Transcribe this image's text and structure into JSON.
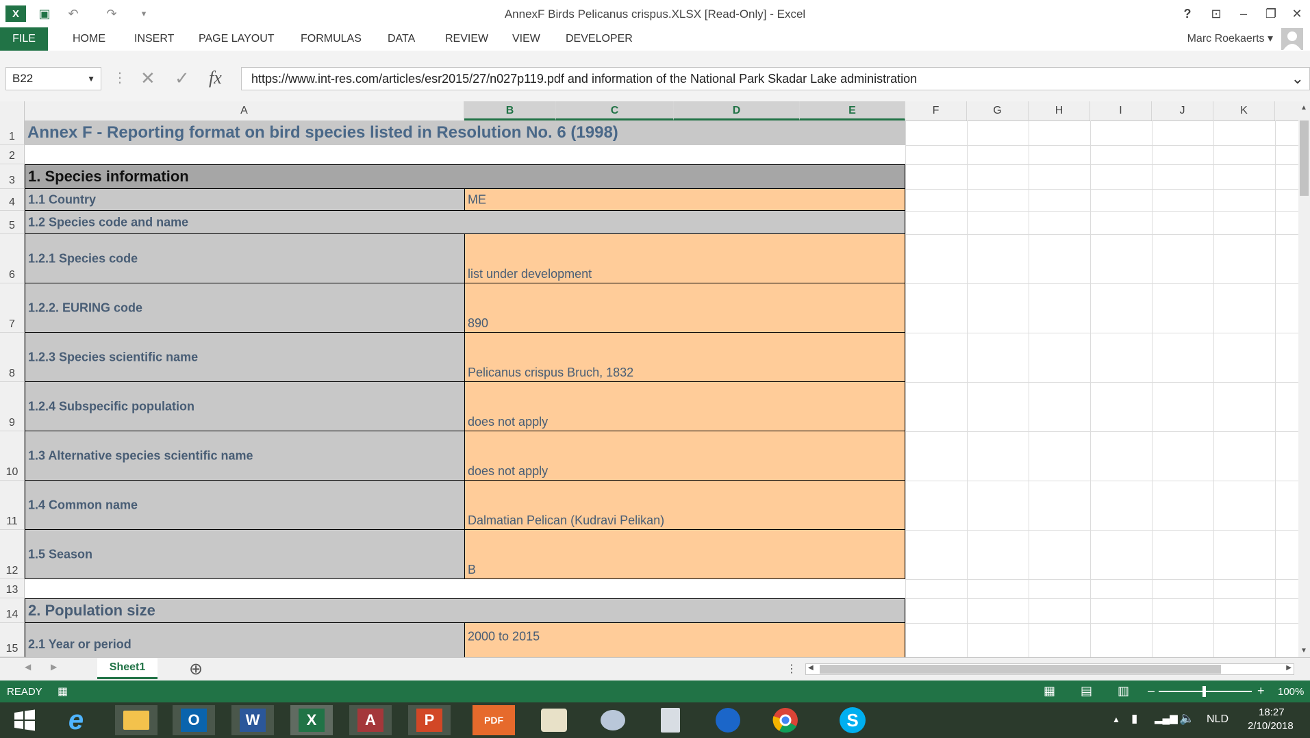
{
  "window": {
    "title": "AnnexF Birds Pelicanus crispus.XLSX  [Read-Only] - Excel",
    "help": "?",
    "ribbon_display": "⊡",
    "minimize": "–",
    "restore": "❐",
    "close": "✕"
  },
  "quick_access": {
    "app_icon": "X",
    "save_icon": "▣",
    "undo_icon": "↶",
    "redo_icon": "↷",
    "customize_icon": "▾"
  },
  "ribbon": {
    "tabs": [
      "FILE",
      "HOME",
      "INSERT",
      "PAGE LAYOUT",
      "FORMULAS",
      "DATA",
      "REVIEW",
      "VIEW",
      "DEVELOPER"
    ],
    "user": "Marc Roekaerts ▾"
  },
  "formula_bar": {
    "name_box": "B22",
    "formula": "https://www.int-res.com/articles/esr2015/27/n027p119.pdf and information of the National Park Skadar Lake administration",
    "fx": "fx",
    "cancel": "✕",
    "enter": "✓",
    "dots": "⋮",
    "expand": "⌄"
  },
  "columns": [
    "A",
    "B",
    "C",
    "D",
    "E",
    "F",
    "G",
    "H",
    "I",
    "J",
    "K"
  ],
  "rows": [
    "1",
    "2",
    "3",
    "4",
    "5",
    "6",
    "7",
    "8",
    "9",
    "10",
    "11",
    "12",
    "13",
    "14",
    "15"
  ],
  "cells": {
    "title": "Annex F - Reporting format on bird species listed in Resolution No. 6 (1998)",
    "s1": "1.   Species information",
    "r4_label": "1.1    Country",
    "r4_value": "ME",
    "r5_label": "1.2    Species code and name",
    "r6_label": "1.2.1 Species code",
    "r6_value": "list under development",
    "r7_label": "1.2.2. EURING code",
    "r7_value": "890",
    "r8_label": "1.2.3 Species scientific name",
    "r8_value": "Pelicanus crispus Bruch, 1832",
    "r9_label": "1.2.4 Subspecific population",
    "r9_value": "does not apply",
    "r10_label": "1.3 Alternative species scientific name",
    "r10_value": "does not apply",
    "r11_label": "1.4 Common name",
    "r11_value": "Dalmatian Pelican (Kudravi Pelikan)",
    "r12_label": "1.5 Season",
    "r12_value": "B",
    "s2": "2.   Population size",
    "r15_label": "2.1 Year or period",
    "r15_value": "2000 to 2015"
  },
  "sheets": {
    "active": "Sheet1",
    "add": "⊕",
    "prev": "◀",
    "next": "▶"
  },
  "status": {
    "mode": "READY",
    "zoom": "100%",
    "zoom_minus": "–",
    "zoom_plus": "+"
  },
  "taskbar": {
    "lang": "NLD",
    "time": "18:27",
    "date": "2/10/2018",
    "apps": [
      "Internet Explorer",
      "File Explorer",
      "Outlook",
      "Word",
      "Excel",
      "Access",
      "PowerPoint",
      "PDF",
      "Viewer",
      "Paint",
      "Calculator",
      "Browser",
      "Chrome",
      "Skype"
    ]
  },
  "colors": {
    "excel_green": "#217346",
    "label_gray": "#c8c8c8",
    "value_orange": "#ffcc99",
    "label_text": "#485d75"
  }
}
